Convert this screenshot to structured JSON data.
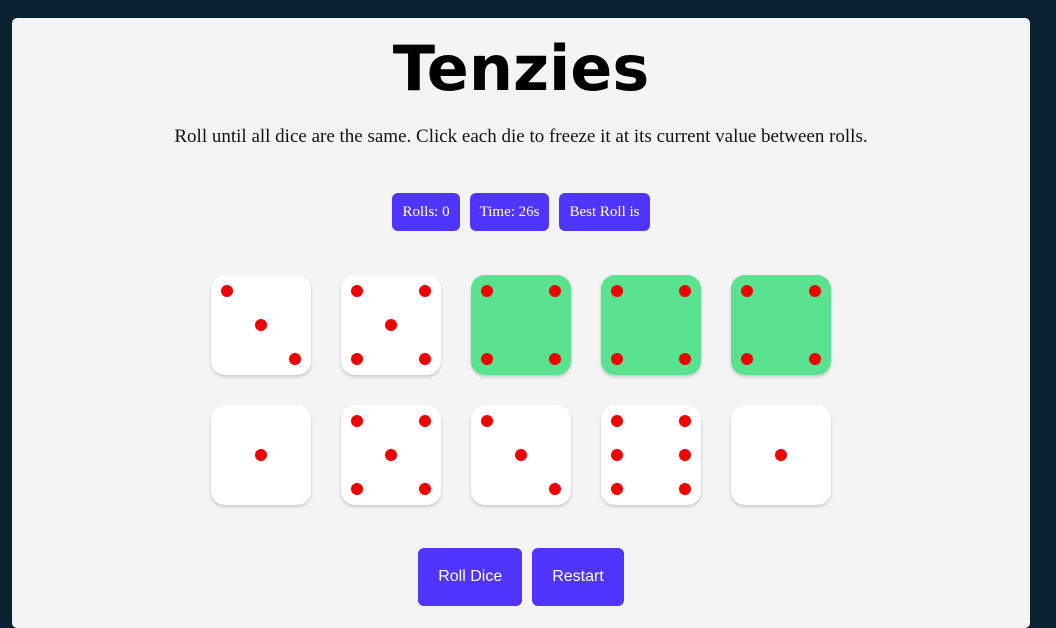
{
  "title": "Tenzies",
  "instructions": "Roll until all dice are the same. Click each die to freeze it at its current value between rolls.",
  "stats": {
    "rolls": "Rolls: 0",
    "time": "Time: 26s",
    "best_roll": "Best Roll is"
  },
  "dice": [
    {
      "value": 3,
      "held": false
    },
    {
      "value": 5,
      "held": false
    },
    {
      "value": 4,
      "held": true
    },
    {
      "value": 4,
      "held": true
    },
    {
      "value": 4,
      "held": true
    },
    {
      "value": 1,
      "held": false
    },
    {
      "value": 5,
      "held": false
    },
    {
      "value": 3,
      "held": false
    },
    {
      "value": 6,
      "held": false
    },
    {
      "value": 1,
      "held": false
    }
  ],
  "buttons": {
    "roll": "Roll Dice",
    "restart": "Restart"
  },
  "colors": {
    "background": "#0b2233",
    "panel": "#f4f4f4",
    "accent": "#5035ff",
    "held_die": "#59e391",
    "pip": "#ee0000"
  }
}
